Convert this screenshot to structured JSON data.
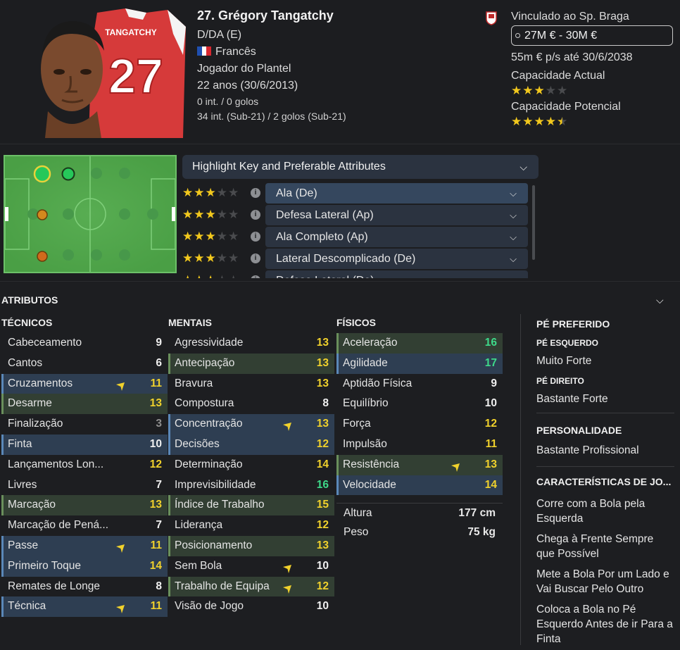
{
  "player": {
    "name": "27. Grégory Tangatchy",
    "position": "D/DA (E)",
    "nationality": "Francês",
    "squad_status": "Jogador do Plantel",
    "age": "22 anos (30/6/2013)",
    "caps": "0 int. / 0 golos",
    "u21_caps": "34 int. (Sub-21) / 2 golos (Sub-21)",
    "shirt_name": "TANGATCHY",
    "shirt_number": "27"
  },
  "club": {
    "contract": "Vinculado ao Sp. Braga",
    "value": "27M € - 30M €",
    "wage": "55m € p/s até 30/6/2038",
    "current_ability_label": "Capacidade Actual",
    "current_ability_stars": 3,
    "potential_ability_label": "Capacidade Potencial",
    "potential_ability_stars": 4.5
  },
  "roles": {
    "header": "Highlight Key and Preferable Attributes",
    "items": [
      {
        "label": "Ala (De)",
        "stars": 3,
        "selected": true
      },
      {
        "label": "Defesa Lateral (Ap)",
        "stars": 3,
        "selected": false
      },
      {
        "label": "Ala Completo (Ap)",
        "stars": 3,
        "selected": false
      },
      {
        "label": "Lateral Descomplicado (De)",
        "stars": 3,
        "selected": false
      },
      {
        "label": "Defesa Lateral (De)",
        "stars": 3,
        "selected": false
      }
    ]
  },
  "attributes": {
    "title": "ATRIBUTOS",
    "technical_title": "TÉCNICOS",
    "mental_title": "MENTAIS",
    "physical_title": "FÍSICOS",
    "technical": [
      {
        "label": "Cabeceamento",
        "value": "9",
        "hl": "",
        "color": "white",
        "arrow": false
      },
      {
        "label": "Cantos",
        "value": "6",
        "hl": "",
        "color": "white",
        "arrow": false
      },
      {
        "label": "Cruzamentos",
        "value": "11",
        "hl": "blue",
        "color": "yellow",
        "arrow": true
      },
      {
        "label": "Desarme",
        "value": "13",
        "hl": "green",
        "color": "yellow",
        "arrow": false
      },
      {
        "label": "Finalização",
        "value": "3",
        "hl": "",
        "color": "grey",
        "arrow": false
      },
      {
        "label": "Finta",
        "value": "10",
        "hl": "blue",
        "color": "white",
        "arrow": false
      },
      {
        "label": "Lançamentos Lon...",
        "value": "12",
        "hl": "",
        "color": "yellow",
        "arrow": false
      },
      {
        "label": "Livres",
        "value": "7",
        "hl": "",
        "color": "white",
        "arrow": false
      },
      {
        "label": "Marcação",
        "value": "13",
        "hl": "green",
        "color": "yellow",
        "arrow": false
      },
      {
        "label": "Marcação de Pená...",
        "value": "7",
        "hl": "",
        "color": "white",
        "arrow": false
      },
      {
        "label": "Passe",
        "value": "11",
        "hl": "blue",
        "color": "yellow",
        "arrow": true
      },
      {
        "label": "Primeiro Toque",
        "value": "14",
        "hl": "blue",
        "color": "yellow",
        "arrow": false
      },
      {
        "label": "Remates de Longe",
        "value": "8",
        "hl": "",
        "color": "white",
        "arrow": false
      },
      {
        "label": "Técnica",
        "value": "11",
        "hl": "blue",
        "color": "yellow",
        "arrow": true
      }
    ],
    "mental": [
      {
        "label": "Agressividade",
        "value": "13",
        "hl": "",
        "color": "yellow",
        "arrow": false
      },
      {
        "label": "Antecipação",
        "value": "13",
        "hl": "green",
        "color": "yellow",
        "arrow": false
      },
      {
        "label": "Bravura",
        "value": "13",
        "hl": "",
        "color": "yellow",
        "arrow": false
      },
      {
        "label": "Compostura",
        "value": "8",
        "hl": "",
        "color": "white",
        "arrow": false
      },
      {
        "label": "Concentração",
        "value": "13",
        "hl": "blue",
        "color": "yellow",
        "arrow": true
      },
      {
        "label": "Decisões",
        "value": "12",
        "hl": "blue",
        "color": "yellow",
        "arrow": false
      },
      {
        "label": "Determinação",
        "value": "14",
        "hl": "",
        "color": "yellow",
        "arrow": false
      },
      {
        "label": "Imprevisibilidade",
        "value": "16",
        "hl": "",
        "color": "green",
        "arrow": false
      },
      {
        "label": "Índice de Trabalho",
        "value": "15",
        "hl": "green",
        "color": "yellow",
        "arrow": false
      },
      {
        "label": "Liderança",
        "value": "12",
        "hl": "",
        "color": "yellow",
        "arrow": false
      },
      {
        "label": "Posicionamento",
        "value": "13",
        "hl": "green",
        "color": "yellow",
        "arrow": false
      },
      {
        "label": "Sem Bola",
        "value": "10",
        "hl": "",
        "color": "white",
        "arrow": true
      },
      {
        "label": "Trabalho de Equipa",
        "value": "12",
        "hl": "green",
        "color": "yellow",
        "arrow": true
      },
      {
        "label": "Visão de Jogo",
        "value": "10",
        "hl": "",
        "color": "white",
        "arrow": false
      }
    ],
    "physical": [
      {
        "label": "Aceleração",
        "value": "16",
        "hl": "green",
        "color": "green",
        "arrow": false
      },
      {
        "label": "Agilidade",
        "value": "17",
        "hl": "blue",
        "color": "green",
        "arrow": false
      },
      {
        "label": "Aptidão Física",
        "value": "9",
        "hl": "",
        "color": "white",
        "arrow": false
      },
      {
        "label": "Equilíbrio",
        "value": "10",
        "hl": "",
        "color": "white",
        "arrow": false
      },
      {
        "label": "Força",
        "value": "12",
        "hl": "",
        "color": "yellow",
        "arrow": false
      },
      {
        "label": "Impulsão",
        "value": "11",
        "hl": "",
        "color": "yellow",
        "arrow": false
      },
      {
        "label": "Resistência",
        "value": "13",
        "hl": "green",
        "color": "yellow",
        "arrow": true
      },
      {
        "label": "Velocidade",
        "value": "14",
        "hl": "blue",
        "color": "yellow",
        "arrow": false
      }
    ],
    "height_label": "Altura",
    "height_value": "177 cm",
    "weight_label": "Peso",
    "weight_value": "75 kg"
  },
  "side": {
    "foot_title": "PÉ PREFERIDO",
    "left_foot_label": "PÉ ESQUERDO",
    "left_foot_value": "Muito Forte",
    "right_foot_label": "PÉ DIREITO",
    "right_foot_value": "Bastante Forte",
    "personality_title": "PERSONALIDADE",
    "personality_value": "Bastante Profissional",
    "traits_title": "CARACTERÍSTICAS DE JO...",
    "traits": [
      "Corre com a Bola pela Esquerda",
      "Chega à Frente Sempre que Possível",
      "Mete a Bola Por um Lado e Vai Buscar Pelo Outro",
      "Coloca a Bola no Pé Esquerdo Antes de ir Para a Finta"
    ]
  },
  "colors": {
    "background": "#1d1e21",
    "panel": "#2b3340",
    "star": "#f2c81d",
    "highlight_blue": "#2e3e52",
    "highlight_green": "#323f33",
    "value_yellow": "#f0d12c",
    "value_green": "#3ed98a",
    "pitch": "#4fa54a"
  }
}
